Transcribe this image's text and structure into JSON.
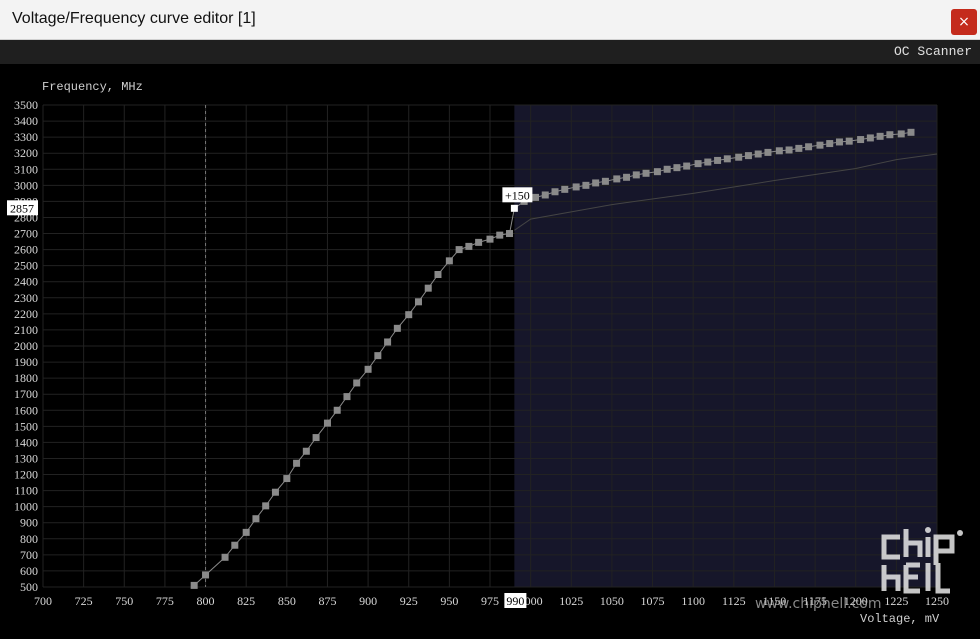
{
  "window": {
    "title": "Voltage/Frequency curve editor [1]",
    "close_label": "×"
  },
  "toolbar": {
    "oc_scanner": "OC Scanner"
  },
  "chart_data": {
    "type": "line",
    "ylabel": "Frequency, MHz",
    "xlabel": "Voltage, mV",
    "xlim": [
      700,
      1250
    ],
    "ylim": [
      500,
      3500
    ],
    "x_ticks": [
      700,
      725,
      750,
      775,
      800,
      825,
      850,
      875,
      900,
      925,
      950,
      975,
      1000,
      1025,
      1050,
      1075,
      1100,
      1125,
      1150,
      1175,
      1200,
      1225,
      1250
    ],
    "y_ticks": [
      500,
      600,
      700,
      800,
      900,
      1000,
      1100,
      1200,
      1300,
      1400,
      1500,
      1600,
      1700,
      1800,
      1900,
      2000,
      2100,
      2200,
      2300,
      2400,
      2500,
      2600,
      2700,
      2800,
      2900,
      3000,
      3100,
      3200,
      3300,
      3400,
      3500
    ],
    "selected_voltage": 990,
    "selected_frequency": 2857,
    "selected_offset_label": "+150",
    "vertical_marker_voltage": 800,
    "highlight_from_voltage": 990,
    "colors": {
      "curve": "#8a8a8a",
      "highlight": "#16162a",
      "grid": "#222222",
      "axis_text": "#d8d8d8"
    },
    "series": [
      {
        "values_x": [
          793,
          800,
          812,
          818,
          825,
          831,
          837,
          843,
          850,
          856,
          862,
          868,
          875,
          881,
          887,
          893,
          900,
          906,
          912,
          918,
          925,
          931,
          937,
          943,
          950,
          956,
          962,
          968,
          975,
          981,
          987,
          990,
          996,
          1003,
          1009,
          1015,
          1021,
          1028,
          1034,
          1040,
          1046,
          1053,
          1059,
          1065,
          1071,
          1078,
          1084,
          1090,
          1096,
          1103,
          1109,
          1115,
          1121,
          1128,
          1134,
          1140,
          1146,
          1153,
          1159,
          1165,
          1171,
          1178,
          1184,
          1190,
          1196,
          1203,
          1209,
          1215,
          1221,
          1228,
          1234
        ],
        "values_y": [
          510,
          575,
          685,
          760,
          840,
          925,
          1005,
          1090,
          1175,
          1270,
          1345,
          1430,
          1520,
          1600,
          1685,
          1770,
          1855,
          1940,
          2025,
          2110,
          2195,
          2275,
          2360,
          2445,
          2530,
          2600,
          2620,
          2645,
          2665,
          2690,
          2700,
          2857,
          2900,
          2925,
          2940,
          2960,
          2975,
          2990,
          3000,
          3015,
          3025,
          3040,
          3050,
          3065,
          3075,
          3085,
          3100,
          3110,
          3120,
          3135,
          3145,
          3155,
          3165,
          3175,
          3185,
          3195,
          3205,
          3215,
          3220,
          3230,
          3240,
          3250,
          3260,
          3270,
          3275,
          3285,
          3295,
          3305,
          3315,
          3320,
          3330
        ]
      },
      {
        "values_x": [
          990,
          1000,
          1050,
          1100,
          1150,
          1200,
          1225,
          1250
        ],
        "values_y": [
          2720,
          2790,
          2880,
          2950,
          3030,
          3105,
          3160,
          3195
        ]
      }
    ]
  },
  "watermark": "www.chiphell.com",
  "logo_text": "chip hell"
}
